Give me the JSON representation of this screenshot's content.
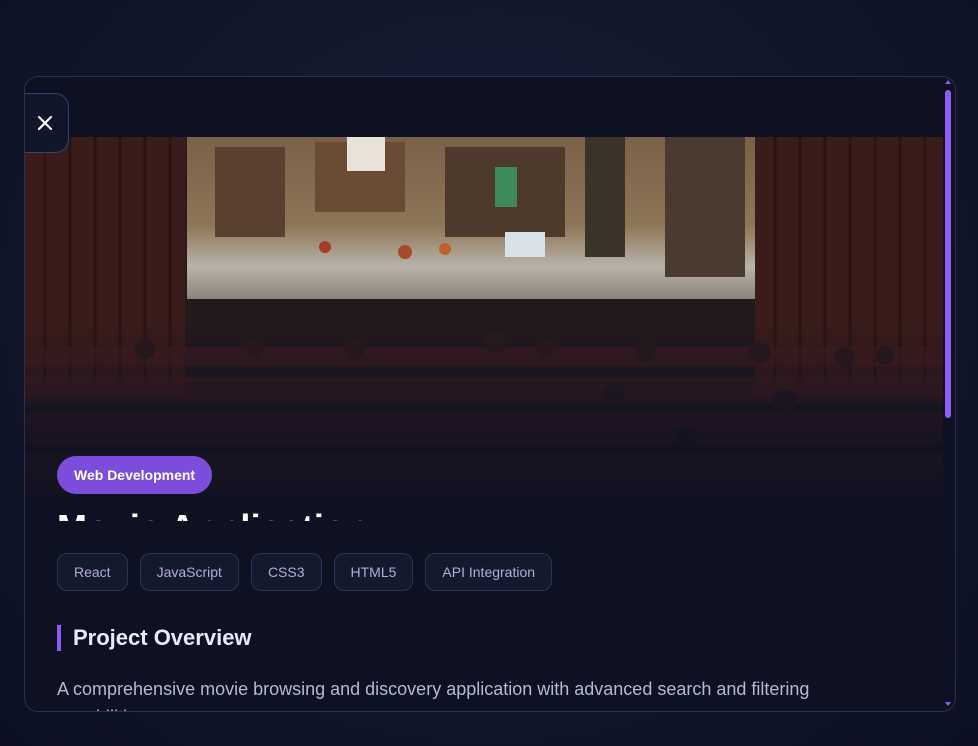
{
  "modal": {
    "close_icon": "close-icon",
    "hero_image": "movie-theater-screen-illustration",
    "category": "Web Development",
    "title": "Movie Application",
    "tags": [
      "React",
      "JavaScript",
      "CSS3",
      "HTML5",
      "API Integration"
    ],
    "section_heading": "Project Overview",
    "overview": "A comprehensive movie browsing and discovery application with advanced search and filtering capabilities."
  },
  "colors": {
    "accent": "#8b5cf6",
    "pill": "#7c4ddb",
    "background": "#0e1122",
    "tag_text": "#aab0d6"
  }
}
